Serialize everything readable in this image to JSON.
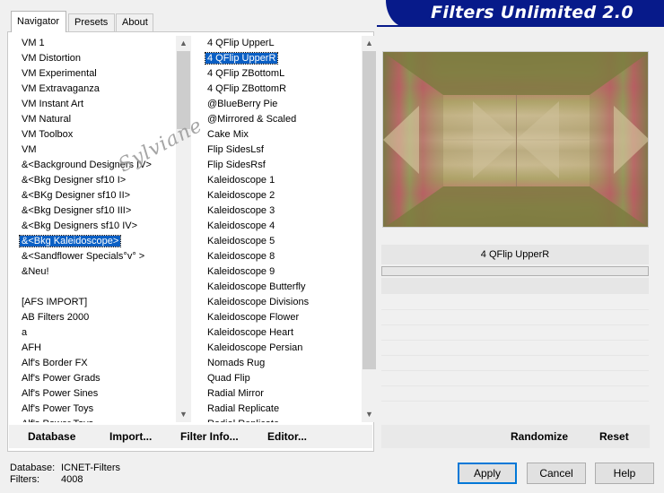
{
  "banner": {
    "title": "Filters Unlimited 2.0"
  },
  "tabs": [
    {
      "label": "Navigator",
      "active": true
    },
    {
      "label": "Presets",
      "active": false
    },
    {
      "label": "About",
      "active": false
    }
  ],
  "categories": {
    "items": [
      "VM 1",
      "VM Distortion",
      "VM Experimental",
      "VM Extravaganza",
      "VM Instant Art",
      "VM Natural",
      "VM Toolbox",
      "VM",
      "&<Background Designers IV>",
      "&<Bkg Designer sf10 I>",
      "&<BKg Designer sf10 II>",
      "&<Bkg Designer sf10 III>",
      "&<Bkg Designers sf10 IV>",
      "&<Bkg Kaleidoscope>",
      "&<Sandflower Specials°v° >",
      "&Neu!",
      "",
      "[AFS IMPORT]",
      "AB Filters 2000",
      "a",
      "AFH",
      "Alf's Border FX",
      "Alf's Power Grads",
      "Alf's Power Sines",
      "Alf's Power Toys",
      "Alf's Power Toys"
    ],
    "selected_index": 13
  },
  "filters": {
    "items": [
      "4 QFlip UpperL",
      "4 QFlip UpperR",
      "4 QFlip ZBottomL",
      "4 QFlip ZBottomR",
      "@BlueBerry Pie",
      "@Mirrored & Scaled",
      "Cake Mix",
      "Flip SidesLsf",
      "Flip SidesRsf",
      "Kaleidoscope 1",
      "Kaleidoscope 2",
      "Kaleidoscope 3",
      "Kaleidoscope 4",
      "Kaleidoscope 5",
      "Kaleidoscope 8",
      "Kaleidoscope 9",
      "Kaleidoscope Butterfly",
      "Kaleidoscope Divisions",
      "Kaleidoscope Flower",
      "Kaleidoscope Heart",
      "Kaleidoscope Persian",
      "Nomads Rug",
      "Quad Flip",
      "Radial Mirror",
      "Radial Replicate",
      "Radial Replicate"
    ],
    "selected_index": 1
  },
  "left_buttons": {
    "database": "Database",
    "import": "Import...",
    "filter_info": "Filter Info...",
    "editor": "Editor..."
  },
  "preview": {
    "filter_name": "4 QFlip UpperR",
    "progress": 0
  },
  "right_buttons": {
    "randomize": "Randomize",
    "reset": "Reset"
  },
  "status": {
    "database_label": "Database:",
    "database_value": "ICNET-Filters",
    "filters_label": "Filters:",
    "filters_value": "4008"
  },
  "dialog_buttons": {
    "apply": "Apply",
    "cancel": "Cancel",
    "help": "Help"
  },
  "watermark": "Sylviane",
  "colors": {
    "banner": "#071a8a",
    "selection": "#0a5fc4",
    "default_button_border": "#0078d7",
    "preview_olive": "#8a8748",
    "preview_pink": "#c9566b",
    "preview_tan": "#c9b88e"
  }
}
